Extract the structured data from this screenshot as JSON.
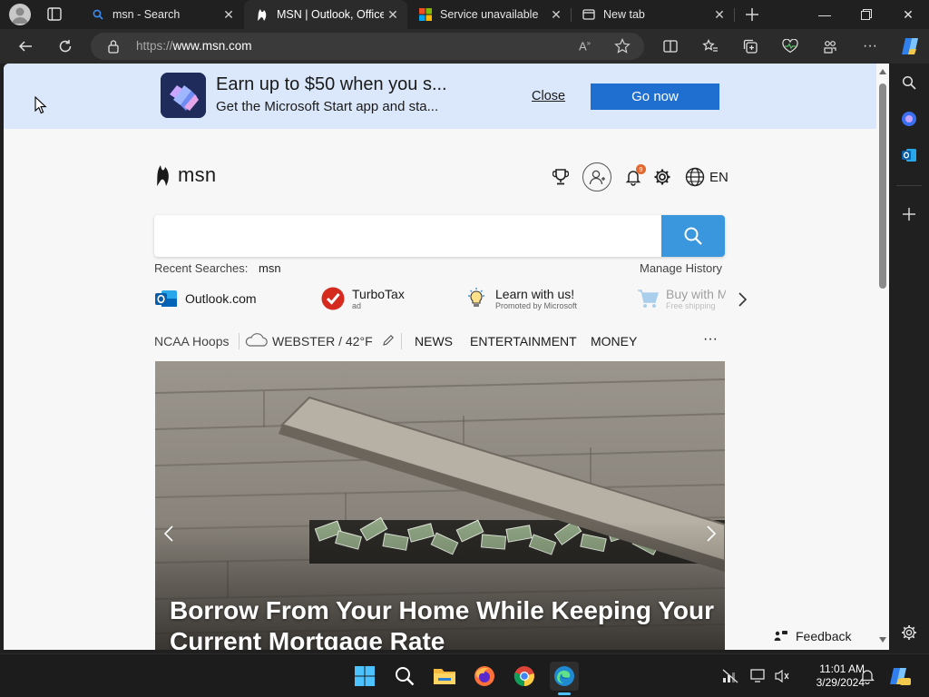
{
  "tabs": [
    {
      "title": "msn - Search",
      "icon": "search-icon",
      "active": false
    },
    {
      "title": "MSN | Outlook, Office",
      "icon": "msn-icon",
      "active": true
    },
    {
      "title": "Service unavailable",
      "icon": "microsoft-icon",
      "active": false
    },
    {
      "title": "New tab",
      "icon": "newtab-icon",
      "active": false
    }
  ],
  "address_bar": {
    "protocol": "https://",
    "domain": "www.msn.com"
  },
  "banner": {
    "headline": "Earn up to $50 when you s...",
    "subtext": "Get the Microsoft Start app and sta...",
    "close_label": "Close",
    "cta_label": "Go now"
  },
  "header": {
    "logo_text": "msn",
    "notification_count": "9",
    "language": "EN"
  },
  "search": {
    "query": "",
    "recent_label": "Recent Searches:",
    "recent_items": [
      "msn"
    ],
    "manage_history_label": "Manage History"
  },
  "quick_links": [
    {
      "label": "Outlook.com",
      "sub": "",
      "icon": "outlook-icon"
    },
    {
      "label": "TurboTax",
      "sub": "ad",
      "icon": "turbotax-icon"
    },
    {
      "label": "Learn with us!",
      "sub": "Promoted by Microsoft",
      "icon": "lightbulb-icon"
    },
    {
      "label": "Buy with M",
      "sub": "Free shipping",
      "icon": "shopping-cart-icon"
    }
  ],
  "nav": {
    "first": "NCAA Hoops",
    "weather": "WEBSTER / 42°F",
    "items": [
      "NEWS",
      "ENTERTAINMENT",
      "MONEY"
    ],
    "more": "···"
  },
  "hero": {
    "caption": "Borrow From Your Home While Keeping Your Current Mortgage Rate"
  },
  "feedback_label": "Feedback",
  "clock": {
    "time": "11:01 AM",
    "date": "3/29/2024"
  },
  "colors": {
    "banner_bg": "#dbe8fb",
    "cta_blue": "#1f6fd1",
    "search_blue": "#3a96dd",
    "notification_badge": "#e3682f"
  }
}
